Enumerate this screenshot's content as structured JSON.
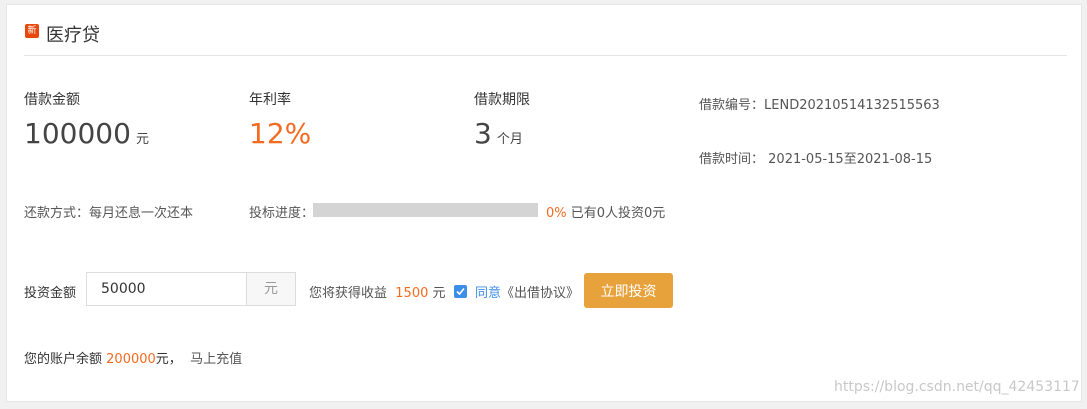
{
  "header": {
    "badge": "新",
    "title": "医疗贷"
  },
  "loan": {
    "amount_label": "借款金额",
    "amount_value": "100000",
    "amount_unit": "元",
    "rate_label": "年利率",
    "rate_value": "12%",
    "term_label": "借款期限",
    "term_value": "3",
    "term_unit": "个月",
    "id_label": "借款编号：",
    "id_value": "LEND20210514132515563",
    "time_label": "借款时间：",
    "time_value": "2021-05-15至2021-08-15",
    "repay_label": "还款方式：",
    "repay_value": "每月还息一次还本",
    "progress_label": "投标进度：",
    "progress_percent": 0,
    "progress_text": "0%",
    "progress_summary": "已有0人投资0元"
  },
  "invest": {
    "label": "投资金额",
    "input_value": "50000",
    "unit": "元",
    "earn_label": "您将获得收益",
    "earn_value": "1500",
    "earn_unit": "元",
    "agree_text": "同意",
    "agreement_title": "《出借协议》",
    "button": "立即投资",
    "agree_checked": true
  },
  "account": {
    "balance_label": "您的账户余额",
    "balance_value": "200000",
    "balance_unit": "元，",
    "recharge_link": "马上充值"
  },
  "watermark": "https://blog.csdn.net/qq_42453117",
  "colors": {
    "accent_orange": "#f36b21",
    "button_bg": "#e8a23b",
    "link_blue": "#3d8ee8",
    "badge_red": "#e8480c"
  }
}
